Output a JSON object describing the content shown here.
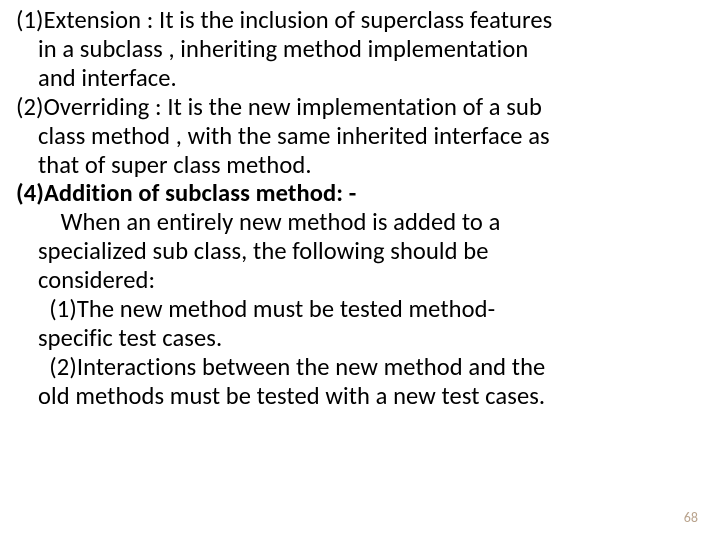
{
  "lines": {
    "l1": "(1)Extension : It is the inclusion of superclass features",
    "l2": "in a subclass , inheriting method implementation",
    "l3": "and interface.",
    "l4": "(2)Overriding : It is the new implementation of a sub",
    "l5": "class method , with the same inherited interface as",
    "l6": "that of super class method.",
    "l7": "(4)Addition of subclass method: -",
    "l8": "    When an entirely new method is added to a",
    "l9": "specialized sub class, the following should be",
    "l10": "considered:",
    "l11": "  (1)The new method must be tested method-",
    "l12": "specific test cases.",
    "l13": "  (2)Interactions between the new method and the",
    "l14": "old methods must be tested with a new test cases."
  },
  "page_number": "68"
}
